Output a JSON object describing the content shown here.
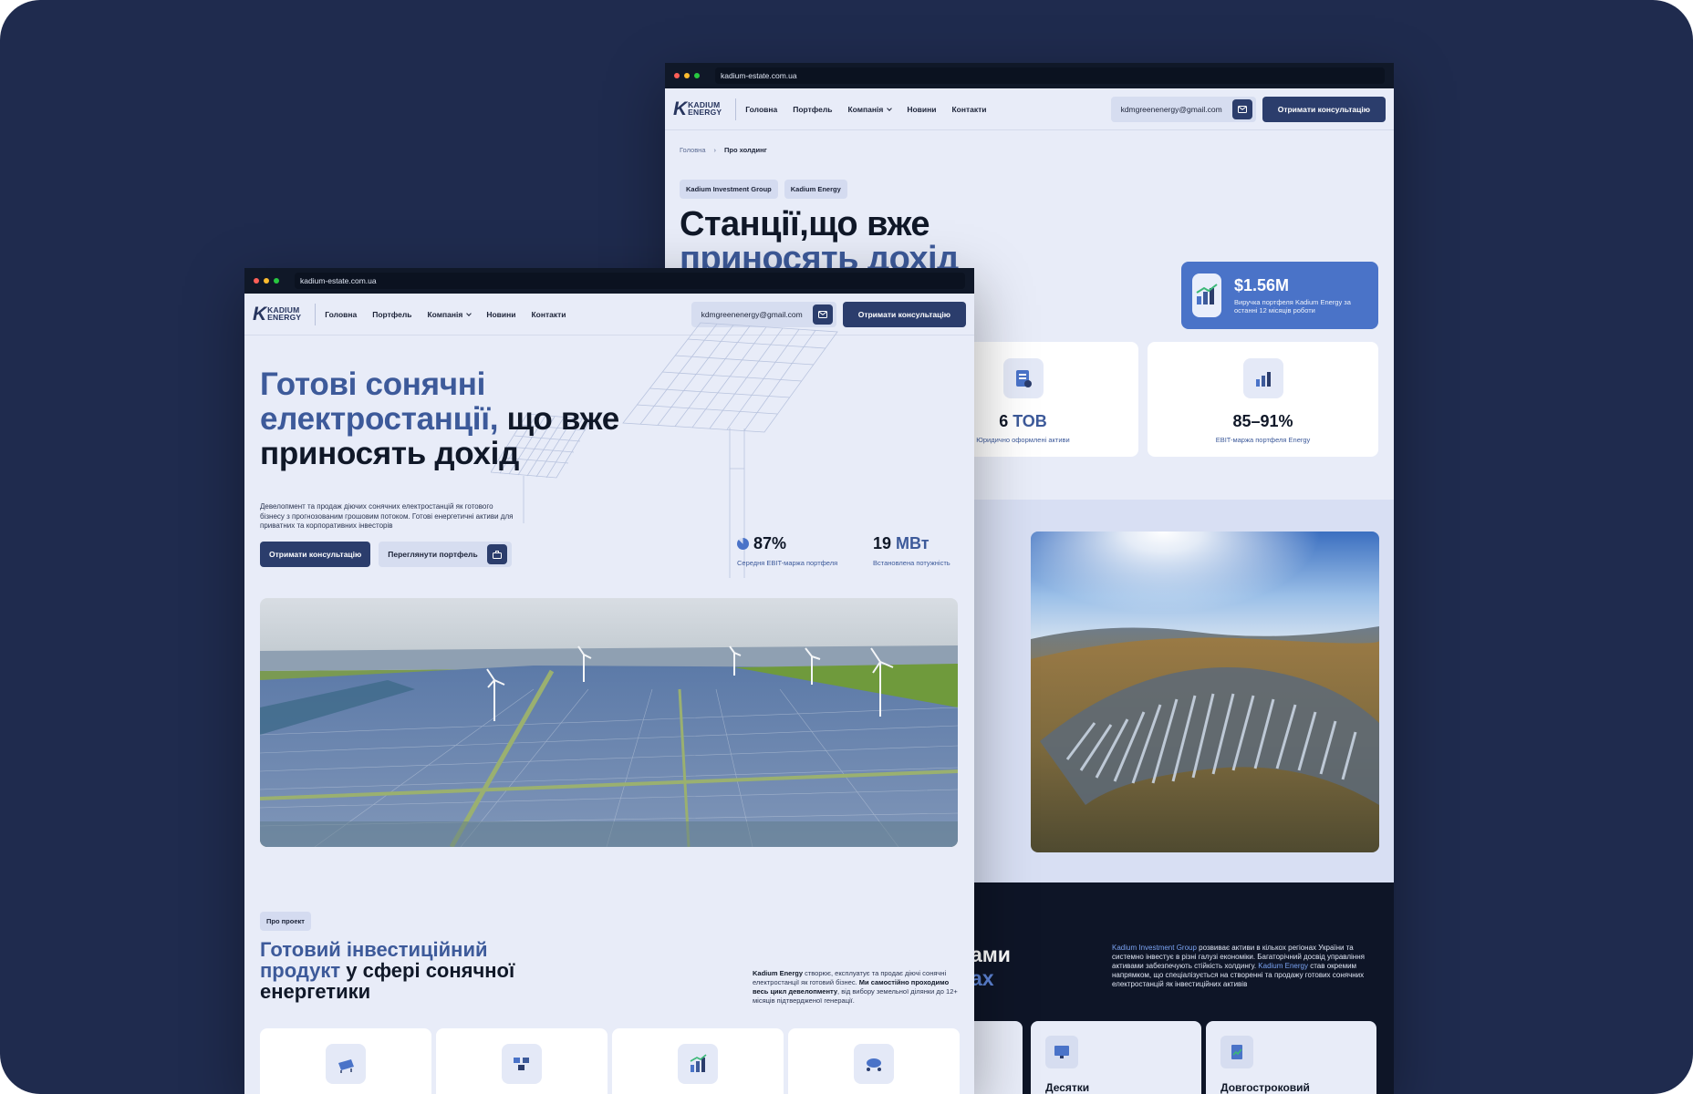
{
  "colors": {
    "background": "#1f2b4e",
    "primary": "#2b3d6c",
    "accent": "#3d5a9a",
    "highlight": "#4a73c8",
    "dark_section": "#0e1527"
  },
  "back": {
    "url": "kadium-estate.com.ua",
    "logo": {
      "line1": "KADIUM",
      "line2": "ENERGY"
    },
    "nav": [
      "Головна",
      "Портфель",
      "Компанія",
      "Новини",
      "Контакти"
    ],
    "email": "kdmgreenenergy@gmail.com",
    "cta": "Отримати консультацію",
    "breadcrumb": {
      "home": "Головна",
      "current": "Про холдинг"
    },
    "chips": [
      "Kadium Investment Group",
      "Kadium Energy"
    ],
    "title_line1": "Станції,що вже",
    "title_line2": "приносять дохід",
    "revenue": {
      "amount": "$1.56M",
      "desc": "Виручка портфеля Kadium Energy за останні 12 місяців роботи"
    },
    "stats": [
      {
        "num": "6",
        "unit": "ТОВ",
        "label": "Юридично оформлені активи"
      },
      {
        "num": "85–91%",
        "unit": "",
        "label": "EBIT-маржа портфеля Energy"
      }
    ],
    "dark": {
      "heading_a": "ами",
      "heading_b": "ах",
      "text_a": "Kadium Investment Group",
      "text_b": " розвиває активи в кількох регіонах України та системно інвестує в різні галузі економіки. Багаторічний досвід управління активами забезпечують стійкість холдингу. ",
      "text_c": "Kadium Energy",
      "text_d": " став окремим напрямком, що спеціалізується на створенні та продажу готових сонячних електростанцій як інвестиційних активів"
    },
    "cards": [
      "Десятки",
      "Довгостроковий"
    ]
  },
  "front": {
    "url": "kadium-estate.com.ua",
    "logo": {
      "line1": "KADIUM",
      "line2": "ENERGY"
    },
    "nav": [
      "Головна",
      "Портфель",
      "Компанія",
      "Новини",
      "Контакти"
    ],
    "email": "kdmgreenenergy@gmail.com",
    "cta": "Отримати консультацію",
    "hero_hl": "Готові сонячні електростанції,",
    "hero_rest": " що вже приносять дохід",
    "lead": "Девелопмент та продаж діючих сонячних електростанцій як готового бізнесу з прогнозованим грошовим потоком. Готові енергетичні активи для приватних та корпоративних інвесторів",
    "btn_primary": "Отримати консультацію",
    "btn_secondary": "Переглянути портфель",
    "kpi1": {
      "value": "87%",
      "label": "Середня EBIT-маржа портфеля",
      "fraction": 0.87
    },
    "kpi2": {
      "value": "19",
      "unit": "МВт",
      "label": "Встановлена потужність"
    },
    "tag": "Про проект",
    "h2_hl": "Готовий інвестиційний продукт",
    "h2_rest": " у сфері сонячної енергетики",
    "about_b": "Kadium Energy",
    "about_t1": " створює, експлуатує та продає діючі сонячні електростанції як готовий бізнес. ",
    "about_b2": "Ми самостійно проходимо весь цикл девелопменту",
    "about_t2": ", від вибору земельної ділянки до 12+ місяців підтвердженої генерації."
  }
}
